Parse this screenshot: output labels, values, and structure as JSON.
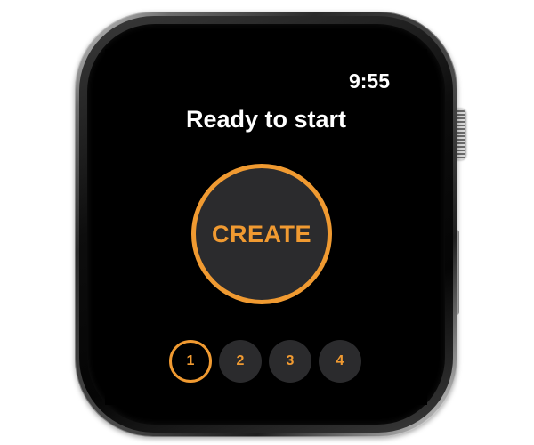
{
  "status": {
    "time": "9:55"
  },
  "screen": {
    "title": "Ready to start",
    "create_label": "CREATE"
  },
  "pages": [
    {
      "label": "1",
      "active": true
    },
    {
      "label": "2",
      "active": false
    },
    {
      "label": "3",
      "active": false
    },
    {
      "label": "4",
      "active": false
    }
  ],
  "colors": {
    "accent": "#f09a31",
    "button_fill": "#2b2b2d",
    "screen_bg": "#000000",
    "text": "#ffffff"
  }
}
